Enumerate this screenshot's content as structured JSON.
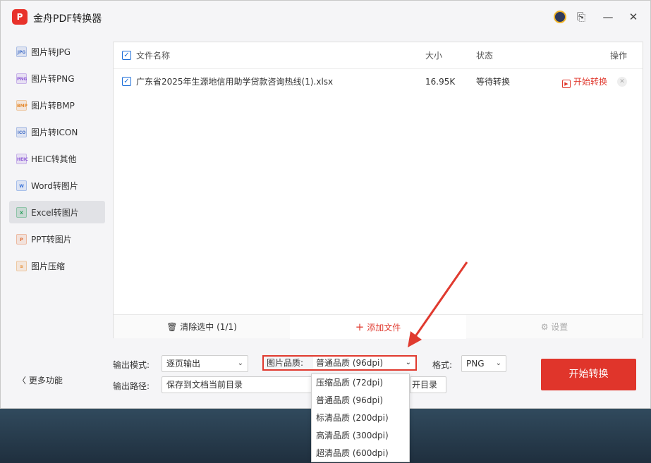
{
  "app": {
    "logo_text": "P",
    "title": "金舟PDF转换器"
  },
  "sidebar": {
    "items": [
      {
        "label": "图片转JPG",
        "icon": "JPG",
        "color": "#4a74c9"
      },
      {
        "label": "图片转PNG",
        "icon": "PNG",
        "color": "#8e5bd6"
      },
      {
        "label": "图片转BMP",
        "icon": "BMP",
        "color": "#e58a2e"
      },
      {
        "label": "图片转ICON",
        "icon": "ICO",
        "color": "#4a74c9"
      },
      {
        "label": "HEIC转其他",
        "icon": "HEIC",
        "color": "#8e5bd6"
      },
      {
        "label": "Word转图片",
        "icon": "W",
        "color": "#3a73d8"
      },
      {
        "label": "Excel转图片",
        "icon": "X",
        "color": "#1f9a55"
      },
      {
        "label": "PPT转图片",
        "icon": "P",
        "color": "#e06a2e"
      },
      {
        "label": "图片压缩",
        "icon": "≋",
        "color": "#e58a2e"
      }
    ],
    "active_index": 6,
    "more_label": "更多功能"
  },
  "table": {
    "headers": {
      "name": "文件名称",
      "size": "大小",
      "status": "状态",
      "action": "操作"
    },
    "rows": [
      {
        "name": "广东省2025年生源地信用助学贷款咨询热线(1).xlsx",
        "size": "16.95K",
        "status": "等待转换",
        "action": "开始转换"
      }
    ]
  },
  "panel_footer": {
    "clear": "清除选中 (1/1)",
    "add": "添加文件",
    "settings": "设置"
  },
  "options": {
    "output_mode_label": "输出模式:",
    "output_mode_value": "逐页输出",
    "quality_label": "图片品质:",
    "quality_value": "普通品质 (96dpi)",
    "format_label": "格式:",
    "format_value": "PNG",
    "output_path_label": "输出路径:",
    "output_path_value": "保存到文档当前目录",
    "open_dir_label": "打开目录",
    "open_dir_visible": "开目录"
  },
  "quality_options": [
    "压缩品质 (72dpi)",
    "普通品质 (96dpi)",
    "标清品质 (200dpi)",
    "高清品质 (300dpi)",
    "超清品质 (600dpi)"
  ],
  "convert_button": "开始转换",
  "colors": {
    "accent": "#e0352b",
    "check": "#1e6fd9"
  }
}
